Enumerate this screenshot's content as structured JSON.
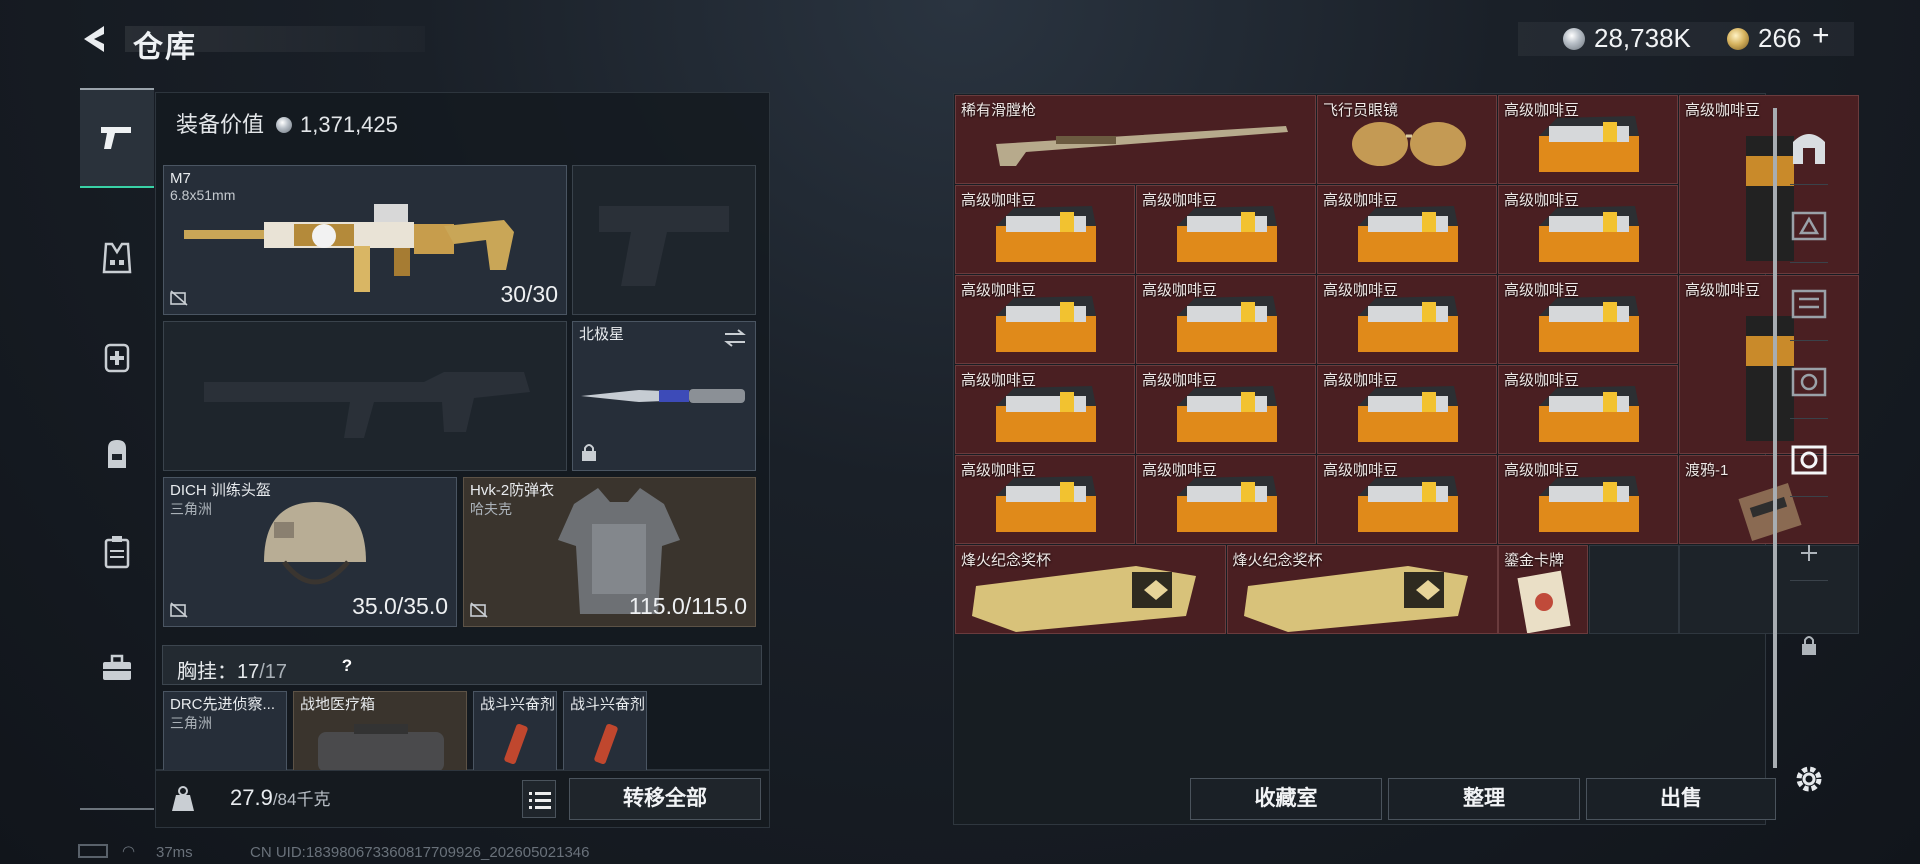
{
  "header": {
    "title": "仓库",
    "silver_currency": "28,738K",
    "gold_currency": "266",
    "add_label": "+"
  },
  "sidenav": {
    "items": [
      {
        "name": "weapons"
      },
      {
        "name": "armor"
      },
      {
        "name": "medical"
      },
      {
        "name": "backpack"
      },
      {
        "name": "containers"
      },
      {
        "name": "toolbox"
      }
    ]
  },
  "loadout": {
    "equip_value_label": "装备价值",
    "equip_value": "1,371,425",
    "primary": {
      "name": "M7",
      "caliber": "6.8x51mm",
      "ammo": "30/30"
    },
    "secondary_melee": {
      "name": "北极星"
    },
    "helmet": {
      "name": "DICH 训练头盔",
      "map": "三角洲",
      "durability": "35.0/35.0"
    },
    "armor": {
      "name": "Hvk-2防弹衣",
      "map": "哈夫克",
      "durability": "115.0/115.0"
    },
    "chest_rig": {
      "label": "胸挂：",
      "used": "17",
      "cap": "/17",
      "help": "?"
    },
    "rig_items": [
      {
        "name": "DRC先进侦察...",
        "sub": "三角洲"
      },
      {
        "name": "战地医疗箱",
        "sub": ""
      },
      {
        "name": "战斗兴奋剂",
        "sub": ""
      },
      {
        "name": "战斗兴奋剂",
        "sub": ""
      }
    ],
    "weight": "27.9",
    "weight_cap": "/84千克",
    "move_all": "转移全部"
  },
  "stash": {
    "items": [
      {
        "name": "稀有滑膛枪",
        "kind": "musket"
      },
      {
        "name": "飞行员眼镜",
        "kind": "glasses"
      },
      {
        "name": "高级咖啡豆",
        "kind": "coffee-box"
      },
      {
        "name": "高级咖啡豆",
        "kind": "coffee-bag"
      },
      {
        "name": "高级咖啡豆",
        "kind": "coffee-box"
      },
      {
        "name": "高级咖啡豆",
        "kind": "coffee-box"
      },
      {
        "name": "高级咖啡豆",
        "kind": "coffee-box"
      },
      {
        "name": "高级咖啡豆",
        "kind": "coffee-box"
      },
      {
        "name": "高级咖啡豆",
        "kind": "coffee-box"
      },
      {
        "name": "高级咖啡豆",
        "kind": "coffee-box"
      },
      {
        "name": "高级咖啡豆",
        "kind": "coffee-box"
      },
      {
        "name": "高级咖啡豆",
        "kind": "coffee-box"
      },
      {
        "name": "高级咖啡豆",
        "kind": "coffee-bag"
      },
      {
        "name": "高级咖啡豆",
        "kind": "coffee-box"
      },
      {
        "name": "高级咖啡豆",
        "kind": "coffee-box"
      },
      {
        "name": "高级咖啡豆",
        "kind": "coffee-box"
      },
      {
        "name": "高级咖啡豆",
        "kind": "coffee-box"
      },
      {
        "name": "高级咖啡豆",
        "kind": "coffee-box"
      },
      {
        "name": "高级咖啡豆",
        "kind": "coffee-box"
      },
      {
        "name": "高级咖啡豆",
        "kind": "coffee-box"
      },
      {
        "name": "高级咖啡豆",
        "kind": "coffee-box"
      },
      {
        "name": "渡鸦-1",
        "kind": "card"
      },
      {
        "name": "烽火纪念奖杯",
        "kind": "trophy"
      },
      {
        "name": "烽火纪念奖杯",
        "kind": "trophy"
      },
      {
        "name": "鎏金卡牌",
        "kind": "gold-card"
      }
    ],
    "buttons": {
      "collection": "收藏室",
      "sort": "整理",
      "sell": "出售"
    }
  },
  "rightnav": {
    "items": [
      "arch",
      "I",
      "III",
      "IV",
      "IV-active",
      "add",
      "lock",
      "settings"
    ]
  },
  "status": {
    "ping": "37ms",
    "uid": "CN UID:18398067336081770992​6_202605021346"
  },
  "colors": {
    "stash_cell": "#4a1f22",
    "accent_green": "#39d1a6",
    "gold": "#d6b35f"
  }
}
